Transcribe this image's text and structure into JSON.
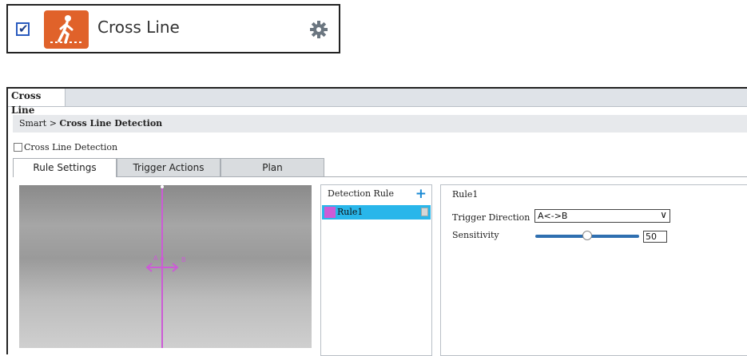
{
  "widget": {
    "enabled_checked": true,
    "title": "Cross Line",
    "icons": {
      "app": "cross-line-walker-icon",
      "settings": "gear-icon",
      "checkbox": "checkbox-checked-icon"
    },
    "accent_color": "#e0622a"
  },
  "window": {
    "tab_label": "Cross Line",
    "breadcrumb": {
      "root": "Smart",
      "separator": ">",
      "current": "Cross Line Detection"
    },
    "enable_label": "Cross Line Detection",
    "enable_checked": false,
    "tabs": [
      "Rule Settings",
      "Trigger Actions",
      "Plan"
    ],
    "active_tab": "Rule Settings"
  },
  "rules": {
    "header": "Detection Rule",
    "add_icon": "plus-icon",
    "items": [
      {
        "name": "Rule1",
        "color": "#cc5bd6",
        "selected": true
      }
    ],
    "delete_icon": "trash-icon"
  },
  "config": {
    "title": "Rule1",
    "trigger_direction_label": "Trigger Direction",
    "trigger_direction_value": "A<->B",
    "sensitivity_label": "Sensitivity",
    "sensitivity_value": "50",
    "sensitivity_fraction": 0.5
  },
  "colors": {
    "line": "#cc5bd6",
    "selected_row": "#29b6ea",
    "add": "#1a8ad4"
  }
}
